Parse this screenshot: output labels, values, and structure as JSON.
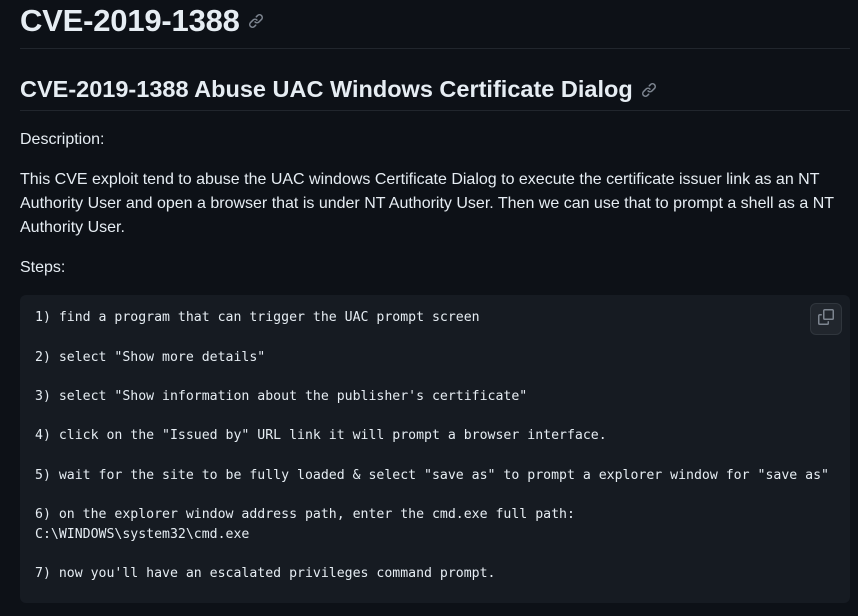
{
  "heading1": {
    "text": "CVE-2019-1388",
    "anchor_icon": "link-icon"
  },
  "heading2": {
    "text": "CVE-2019-1388 Abuse UAC Windows Certificate Dialog",
    "anchor_icon": "link-icon"
  },
  "description": {
    "label": "Description:",
    "body": "This CVE exploit tend to abuse the UAC windows Certificate Dialog to execute the certificate issuer link as an NT Authority User and open a browser that is under NT Authority User. Then we can use that to prompt a shell as a NT Authority User."
  },
  "steps": {
    "label": "Steps:",
    "code_lines": [
      "1) find a program that can trigger the UAC prompt screen",
      "2) select \"Show more details\"",
      "3) select \"Show information about the publisher's certificate\"",
      "4) click on the \"Issued by\" URL link it will prompt a browser interface.",
      "5) wait for the site to be fully loaded & select \"save as\" to prompt a explorer window for \"save as\"",
      "6) on the explorer window address path, enter the cmd.exe full path:",
      "C:\\WINDOWS\\system32\\cmd.exe",
      "7) now you'll have an escalated privileges command prompt."
    ],
    "copy_icon": "copy-icon"
  },
  "colors": {
    "background": "#0d1117",
    "code_background": "#161b22",
    "text": "#e6edf3",
    "muted": "#7d8590",
    "border": "#21262d"
  }
}
